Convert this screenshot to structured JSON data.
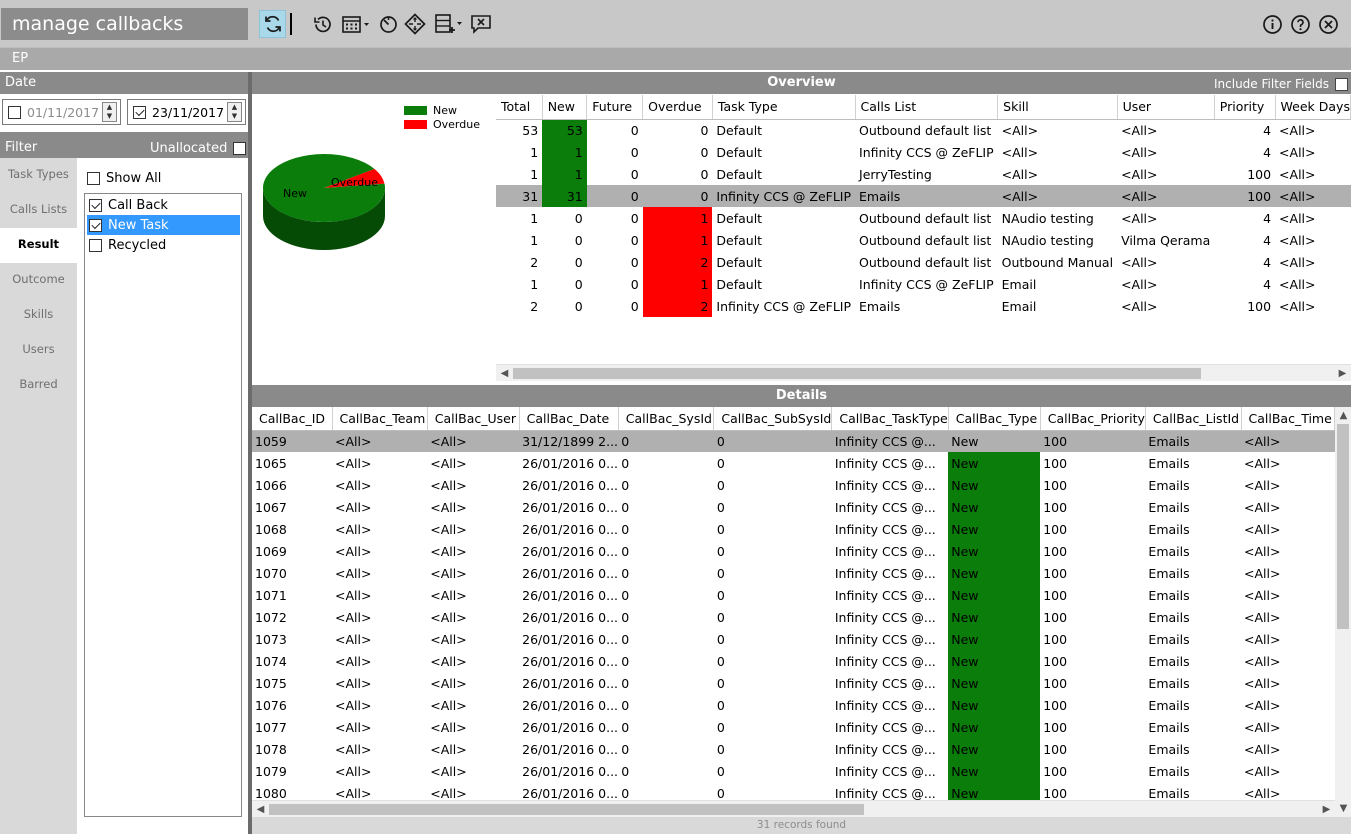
{
  "app": {
    "title": "manage callbacks",
    "section": "EP"
  },
  "toolbar": {
    "left_icons": [
      "refresh-icon",
      "history-icon",
      "calendar-icon",
      "timer-icon",
      "navigate-icon",
      "add-list-icon",
      "message-close-icon"
    ],
    "right_icons": [
      "info-icon",
      "help-icon",
      "close-icon"
    ]
  },
  "date": {
    "label": "Date",
    "from": {
      "checked": false,
      "value": "01/11/2017"
    },
    "to": {
      "checked": true,
      "value": "23/11/2017"
    }
  },
  "filter": {
    "label": "Filter",
    "unallocated_label": "Unallocated",
    "unallocated_checked": false,
    "tabs": [
      "Task Types",
      "Calls Lists",
      "Result",
      "Outcome",
      "Skills",
      "Users",
      "Barred"
    ],
    "active_tab": "Result",
    "show_all": {
      "label": "Show All",
      "checked": false
    },
    "results": [
      {
        "label": "Call Back",
        "checked": true,
        "selected": false
      },
      {
        "label": "New Task",
        "checked": true,
        "selected": true
      },
      {
        "label": "Recycled",
        "checked": false,
        "selected": false
      }
    ]
  },
  "overview": {
    "title": "Overview",
    "include_filter_label": "Include Filter Fields",
    "include_filter_checked": false,
    "columns": [
      "Total",
      "New",
      "Future",
      "Overdue",
      "Task Type",
      "Calls List",
      "Skill",
      "User",
      "Priority",
      "Week Days"
    ],
    "rows": [
      {
        "total": "53",
        "new": "53",
        "future": "0",
        "overdue": "0",
        "task_type": "Default",
        "calls_list": "Outbound default list",
        "skill": "<All>",
        "user": "<All>",
        "priority": "4",
        "week": "<All>",
        "sel": false
      },
      {
        "total": "1",
        "new": "1",
        "future": "0",
        "overdue": "0",
        "task_type": "Default",
        "calls_list": "Infinity CCS @ ZeFLIP",
        "skill": "<All>",
        "user": "<All>",
        "priority": "4",
        "week": "<All>",
        "sel": false
      },
      {
        "total": "1",
        "new": "1",
        "future": "0",
        "overdue": "0",
        "task_type": "Default",
        "calls_list": "JerryTesting",
        "skill": "<All>",
        "user": "<All>",
        "priority": "100",
        "week": "<All>",
        "sel": false
      },
      {
        "total": "31",
        "new": "31",
        "future": "0",
        "overdue": "0",
        "task_type": "Infinity CCS @ ZeFLIP",
        "calls_list": "Emails",
        "skill": "<All>",
        "user": "<All>",
        "priority": "100",
        "week": "<All>",
        "sel": true
      },
      {
        "total": "1",
        "new": "0",
        "future": "0",
        "overdue": "1",
        "task_type": "Default",
        "calls_list": "Outbound default list",
        "skill": "NAudio testing",
        "user": "<All>",
        "priority": "4",
        "week": "<All>",
        "sel": false
      },
      {
        "total": "1",
        "new": "0",
        "future": "0",
        "overdue": "1",
        "task_type": "Default",
        "calls_list": "Outbound default list",
        "skill": "NAudio testing",
        "user": "Vilma Qerama",
        "priority": "4",
        "week": "<All>",
        "sel": false
      },
      {
        "total": "2",
        "new": "0",
        "future": "0",
        "overdue": "2",
        "task_type": "Default",
        "calls_list": "Outbound default list",
        "skill": "Outbound Manual",
        "user": "<All>",
        "priority": "4",
        "week": "<All>",
        "sel": false
      },
      {
        "total": "1",
        "new": "0",
        "future": "0",
        "overdue": "1",
        "task_type": "Default",
        "calls_list": "Infinity CCS @ ZeFLIP",
        "skill": "Email",
        "user": "<All>",
        "priority": "4",
        "week": "<All>",
        "sel": false
      },
      {
        "total": "2",
        "new": "0",
        "future": "0",
        "overdue": "2",
        "task_type": "Infinity CCS @ ZeFLIP",
        "calls_list": "Emails",
        "skill": "Email",
        "user": "<All>",
        "priority": "100",
        "week": "<All>",
        "sel": false
      }
    ]
  },
  "chart_data": {
    "type": "pie",
    "title": "",
    "slices": [
      {
        "label": "New",
        "value": 86,
        "color": "#0a7d0a"
      },
      {
        "label": "Overdue",
        "value": 7,
        "color": "#ff0000"
      }
    ],
    "legend": "top-right"
  },
  "details": {
    "title": "Details",
    "columns": [
      "CallBac_ID",
      "CallBac_Team",
      "CallBac_User",
      "CallBac_Date",
      "CallBac_SysId",
      "CallBac_SubSysId",
      "CallBac_TaskType",
      "CallBac_Type",
      "CallBac_Priority",
      "CallBac_ListId",
      "CallBac_Time"
    ],
    "rows": [
      [
        "1059",
        "<All>",
        "<All>",
        "31/12/1899 2...",
        "0",
        "0",
        "Infinity CCS @...",
        "New",
        "100",
        "Emails",
        "<All>"
      ],
      [
        "1065",
        "<All>",
        "<All>",
        "26/01/2016 0...",
        "0",
        "0",
        "Infinity CCS @...",
        "New",
        "100",
        "Emails",
        "<All>"
      ],
      [
        "1066",
        "<All>",
        "<All>",
        "26/01/2016 0...",
        "0",
        "0",
        "Infinity CCS @...",
        "New",
        "100",
        "Emails",
        "<All>"
      ],
      [
        "1067",
        "<All>",
        "<All>",
        "26/01/2016 0...",
        "0",
        "0",
        "Infinity CCS @...",
        "New",
        "100",
        "Emails",
        "<All>"
      ],
      [
        "1068",
        "<All>",
        "<All>",
        "26/01/2016 0...",
        "0",
        "0",
        "Infinity CCS @...",
        "New",
        "100",
        "Emails",
        "<All>"
      ],
      [
        "1069",
        "<All>",
        "<All>",
        "26/01/2016 0...",
        "0",
        "0",
        "Infinity CCS @...",
        "New",
        "100",
        "Emails",
        "<All>"
      ],
      [
        "1070",
        "<All>",
        "<All>",
        "26/01/2016 0...",
        "0",
        "0",
        "Infinity CCS @...",
        "New",
        "100",
        "Emails",
        "<All>"
      ],
      [
        "1071",
        "<All>",
        "<All>",
        "26/01/2016 0...",
        "0",
        "0",
        "Infinity CCS @...",
        "New",
        "100",
        "Emails",
        "<All>"
      ],
      [
        "1072",
        "<All>",
        "<All>",
        "26/01/2016 0...",
        "0",
        "0",
        "Infinity CCS @...",
        "New",
        "100",
        "Emails",
        "<All>"
      ],
      [
        "1073",
        "<All>",
        "<All>",
        "26/01/2016 0...",
        "0",
        "0",
        "Infinity CCS @...",
        "New",
        "100",
        "Emails",
        "<All>"
      ],
      [
        "1074",
        "<All>",
        "<All>",
        "26/01/2016 0...",
        "0",
        "0",
        "Infinity CCS @...",
        "New",
        "100",
        "Emails",
        "<All>"
      ],
      [
        "1075",
        "<All>",
        "<All>",
        "26/01/2016 0...",
        "0",
        "0",
        "Infinity CCS @...",
        "New",
        "100",
        "Emails",
        "<All>"
      ],
      [
        "1076",
        "<All>",
        "<All>",
        "26/01/2016 0...",
        "0",
        "0",
        "Infinity CCS @...",
        "New",
        "100",
        "Emails",
        "<All>"
      ],
      [
        "1077",
        "<All>",
        "<All>",
        "26/01/2016 0...",
        "0",
        "0",
        "Infinity CCS @...",
        "New",
        "100",
        "Emails",
        "<All>"
      ],
      [
        "1078",
        "<All>",
        "<All>",
        "26/01/2016 0...",
        "0",
        "0",
        "Infinity CCS @...",
        "New",
        "100",
        "Emails",
        "<All>"
      ],
      [
        "1079",
        "<All>",
        "<All>",
        "26/01/2016 0...",
        "0",
        "0",
        "Infinity CCS @...",
        "New",
        "100",
        "Emails",
        "<All>"
      ],
      [
        "1080",
        "<All>",
        "<All>",
        "26/01/2016 0...",
        "0",
        "0",
        "Infinity CCS @...",
        "New",
        "100",
        "Emails",
        "<All>"
      ]
    ],
    "status": "31 records found"
  },
  "colors": {
    "new": "#0a7d0a",
    "overdue": "#ff0000",
    "selected_row": "#b0b0b0",
    "header_gray": "#8a8a8a"
  }
}
